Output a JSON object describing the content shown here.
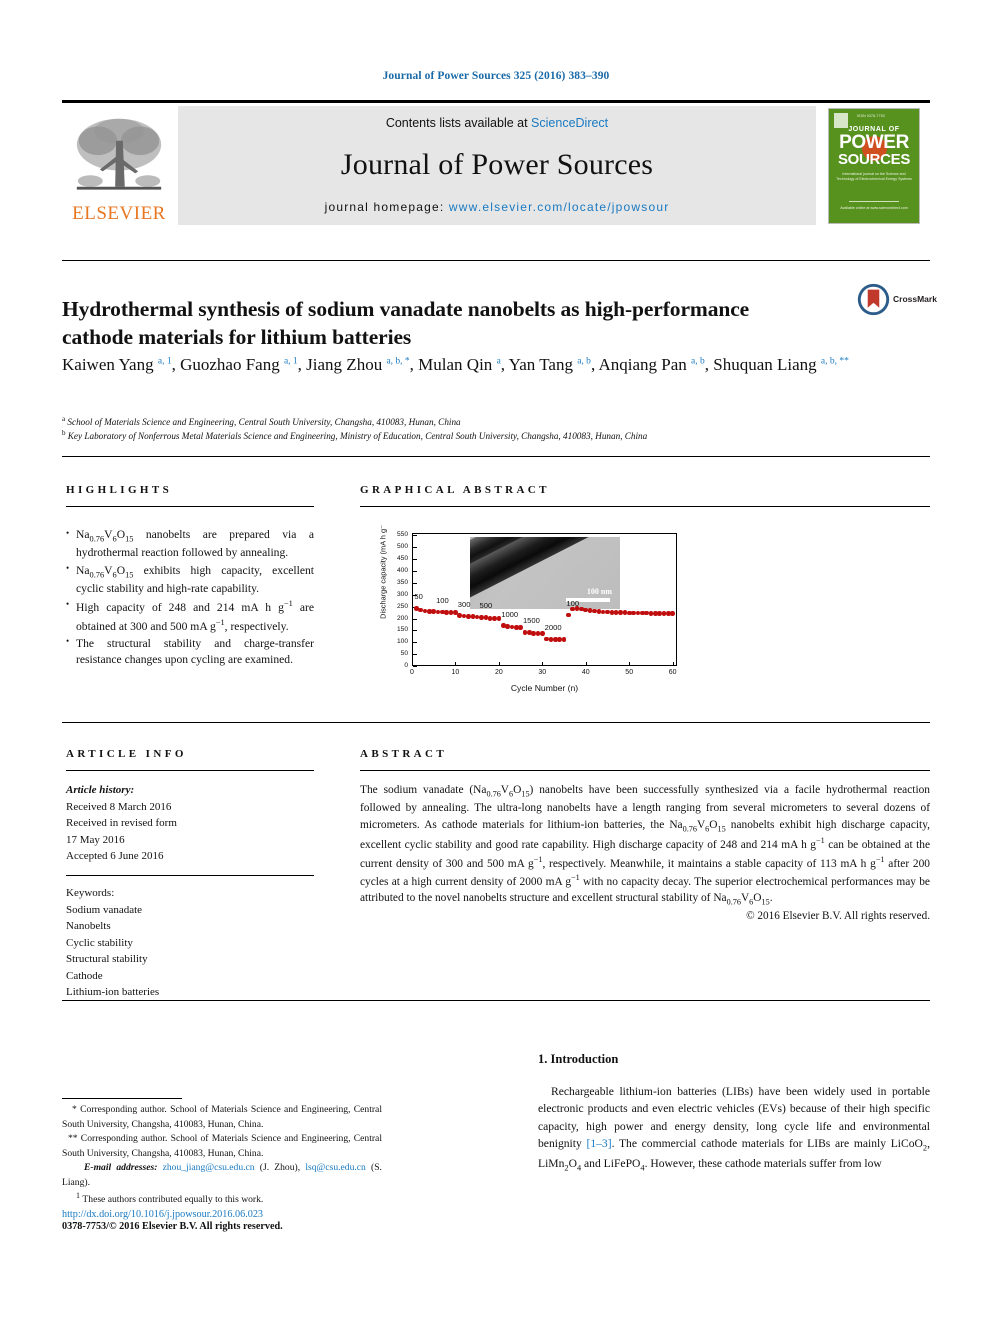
{
  "running_head": "Journal of Power Sources 325 (2016) 383–390",
  "masthead": {
    "contents_prefix": "Contents lists available at ",
    "contents_link": "ScienceDirect",
    "journal_name": "Journal of Power Sources",
    "homepage_prefix": "journal homepage: ",
    "homepage_url": "www.elsevier.com/locate/jpowsour",
    "publisher": "ELSEVIER",
    "cover": {
      "kicker": "JOURNAL OF",
      "line1": "POWER",
      "line2": "SOURCES",
      "blurb": "International journal on the Science and Technology of Electrochemical Energy Systems",
      "footer": "Available online at www.sciencedirect.com"
    }
  },
  "article": {
    "title": "Hydrothermal synthesis of sodium vanadate nanobelts as high-performance cathode materials for lithium batteries",
    "crossmark_label": "CrossMark",
    "authors_html": "Kaiwen Yang <sup>a, 1</sup>, Guozhao Fang <sup>a, 1</sup>, Jiang Zhou <sup>a, b, *</sup>, Mulan Qin <sup>a</sup>, Yan Tang <sup>a, b</sup>, Anqiang Pan <sup>a, b</sup>, Shuquan Liang <sup>a, b, **</sup>",
    "affiliation_a": "School of Materials Science and Engineering, Central South University, Changsha, 410083, Hunan, China",
    "affiliation_b": "Key Laboratory of Nonferrous Metal Materials Science and Engineering, Ministry of Education, Central South University, Changsha, 410083, Hunan, China"
  },
  "highlights": {
    "heading": "HIGHLIGHTS",
    "items_html": [
      "Na<sub>0.76</sub>V<sub>6</sub>O<sub>15</sub> nanobelts are prepared via a hydrothermal reaction followed by annealing.",
      "Na<sub>0.76</sub>V<sub>6</sub>O<sub>15</sub> exhibits high capacity, excellent cyclic stability and high-rate capability.",
      "High capacity of 248 and 214 mA h g<sup class=\"num\">−1</sup> are obtained at 300 and 500 mA g<sup class=\"num\">−1</sup>, respectively.",
      "The structural stability and charge-transfer resistance changes upon cycling are examined."
    ]
  },
  "graphical_abstract": {
    "heading": "GRAPHICAL ABSTRACT",
    "inset_scale_label": "100 nm"
  },
  "chart_data": {
    "type": "scatter",
    "title": "",
    "xlabel": "Cycle Number (n)",
    "ylabel": "Discharge capacity (mA h g⁻¹)",
    "xlim": [
      0,
      61
    ],
    "ylim": [
      0,
      560
    ],
    "xticks": [
      0,
      10,
      20,
      30,
      40,
      50,
      60
    ],
    "yticks": [
      0,
      50,
      100,
      150,
      200,
      250,
      300,
      350,
      400,
      450,
      500,
      550
    ],
    "grid": false,
    "legend": "none",
    "marker_color": "#c00d0d",
    "rate_annotations": [
      {
        "label": "50",
        "cycle_start": 1,
        "cycle_end": 5
      },
      {
        "label": "100",
        "cycle_start": 6,
        "cycle_end": 10
      },
      {
        "label": "300",
        "cycle_start": 11,
        "cycle_end": 15
      },
      {
        "label": "500",
        "cycle_start": 16,
        "cycle_end": 20
      },
      {
        "label": "1000",
        "cycle_start": 21,
        "cycle_end": 25
      },
      {
        "label": "1500",
        "cycle_start": 26,
        "cycle_end": 30
      },
      {
        "label": "2000",
        "cycle_start": 31,
        "cycle_end": 35
      },
      {
        "label": "100",
        "cycle_start": 36,
        "cycle_end": 60
      }
    ],
    "x": [
      1,
      2,
      3,
      4,
      5,
      6,
      7,
      8,
      9,
      10,
      11,
      12,
      13,
      14,
      15,
      16,
      17,
      18,
      19,
      20,
      21,
      22,
      23,
      24,
      25,
      26,
      27,
      28,
      29,
      30,
      31,
      32,
      33,
      34,
      35,
      36,
      37,
      38,
      39,
      40,
      41,
      42,
      43,
      44,
      45,
      46,
      47,
      48,
      49,
      50,
      51,
      52,
      53,
      54,
      55,
      56,
      57,
      58,
      59,
      60
    ],
    "y": [
      243,
      236,
      232,
      230,
      229,
      228,
      227,
      226,
      226,
      226,
      212,
      210,
      209,
      208,
      207,
      205,
      203,
      201,
      200,
      199,
      170,
      167,
      165,
      163,
      162,
      142,
      140,
      138,
      137,
      136,
      113,
      112,
      112,
      111,
      111,
      214,
      240,
      241,
      240,
      236,
      233,
      231,
      229,
      228,
      227,
      226,
      226,
      225,
      225,
      224,
      224,
      223,
      223,
      223,
      222,
      222,
      222,
      222,
      221,
      221
    ]
  },
  "article_info": {
    "heading": "ARTICLE INFO",
    "history_label": "Article history:",
    "history": [
      "Received 8 March 2016",
      "Received in revised form",
      "17 May 2016",
      "Accepted 6 June 2016"
    ],
    "keywords_label": "Keywords:",
    "keywords": [
      "Sodium vanadate",
      "Nanobelts",
      "Cyclic stability",
      "Structural stability",
      "Cathode",
      "Lithium-ion batteries"
    ]
  },
  "abstract": {
    "heading": "ABSTRACT",
    "body_html": "The sodium vanadate (Na<sub>0.76</sub>V<sub>6</sub>O<sub>15</sub>) nanobelts have been successfully synthesized via a facile hydrothermal reaction followed by annealing. The ultra-long nanobelts have a length ranging from several micrometers to several dozens of micrometers. As cathode materials for lithium-ion batteries, the Na<sub>0.76</sub>V<sub>6</sub>O<sub>15</sub> nanobelts exhibit high discharge capacity, excellent cyclic stability and good rate capability. High discharge capacity of 248 and 214 mA h g<sup class=\"num\">−1</sup> can be obtained at the current density of 300 and 500 mA g<sup class=\"num\">−1</sup>, respectively. Meanwhile, it maintains a stable capacity of 113 mA h g<sup class=\"num\">−1</sup> after 200 cycles at a high current density of 2000 mA g<sup class=\"num\">−1</sup> with no capacity decay. The superior electrochemical performances may be attributed to the novel nanobelts structure and excellent structural stability of Na<sub>0.76</sub>V<sub>6</sub>O<sub>15</sub>.",
    "copyright": "© 2016 Elsevier B.V. All rights reserved."
  },
  "footnotes": {
    "corresponding_1": "* Corresponding author. School of Materials Science and Engineering, Central South University, Changsha, 410083, Hunan, China.",
    "corresponding_2": "** Corresponding author. School of Materials Science and Engineering, Central South University, Changsha, 410083, Hunan, China.",
    "email_label": "E-mail addresses:",
    "email_1": "zhou_jiang@csu.edu.cn",
    "email_1_person": "(J. Zhou),",
    "email_2": "lsq@csu.edu.cn",
    "email_2_person": "(S. Liang).",
    "equal_contrib": "These authors contributed equally to this work.",
    "doi": "http://dx.doi.org/10.1016/j.jpowsour.2016.06.023",
    "issn": "0378-7753/© 2016 Elsevier B.V. All rights reserved."
  },
  "introduction": {
    "heading": "1. Introduction",
    "body_html": "Rechargeable lithium-ion batteries (LIBs) have been widely used in portable electronic products and even electric vehicles (EVs) because of their high specific capacity, high power and energy density, long cycle life and environmental benignity <a data-name=\"citation-link-1-3\" data-interactable=\"true\">[1–3]</a>. The commercial cathode materials for LIBs are mainly LiCoO<sub>2</sub>, LiMn<sub>2</sub>O<sub>4</sub> and LiFePO<sub>4</sub>. However, these cathode materials suffer from low"
  },
  "colors": {
    "link_blue": "#1a7ac2",
    "elsevier_orange": "#E87722",
    "cover_green": "#57921f",
    "marker_red": "#c00d0d"
  }
}
